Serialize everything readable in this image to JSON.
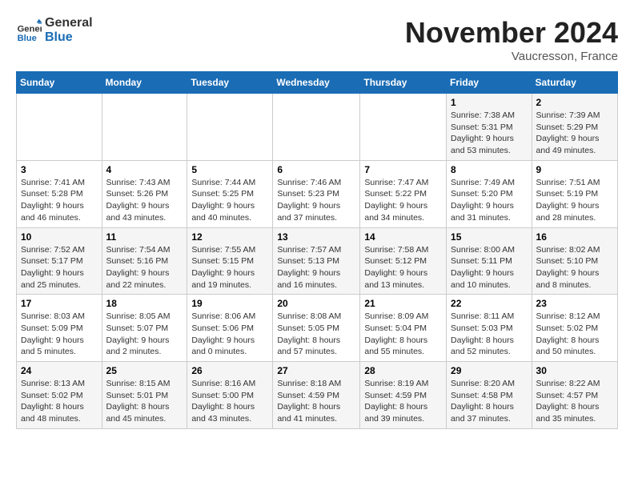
{
  "header": {
    "logo_line1": "General",
    "logo_line2": "Blue",
    "month": "November 2024",
    "location": "Vaucresson, France"
  },
  "weekdays": [
    "Sunday",
    "Monday",
    "Tuesday",
    "Wednesday",
    "Thursday",
    "Friday",
    "Saturday"
  ],
  "weeks": [
    [
      {
        "day": "",
        "info": ""
      },
      {
        "day": "",
        "info": ""
      },
      {
        "day": "",
        "info": ""
      },
      {
        "day": "",
        "info": ""
      },
      {
        "day": "",
        "info": ""
      },
      {
        "day": "1",
        "info": "Sunrise: 7:38 AM\nSunset: 5:31 PM\nDaylight: 9 hours and 53 minutes."
      },
      {
        "day": "2",
        "info": "Sunrise: 7:39 AM\nSunset: 5:29 PM\nDaylight: 9 hours and 49 minutes."
      }
    ],
    [
      {
        "day": "3",
        "info": "Sunrise: 7:41 AM\nSunset: 5:28 PM\nDaylight: 9 hours and 46 minutes."
      },
      {
        "day": "4",
        "info": "Sunrise: 7:43 AM\nSunset: 5:26 PM\nDaylight: 9 hours and 43 minutes."
      },
      {
        "day": "5",
        "info": "Sunrise: 7:44 AM\nSunset: 5:25 PM\nDaylight: 9 hours and 40 minutes."
      },
      {
        "day": "6",
        "info": "Sunrise: 7:46 AM\nSunset: 5:23 PM\nDaylight: 9 hours and 37 minutes."
      },
      {
        "day": "7",
        "info": "Sunrise: 7:47 AM\nSunset: 5:22 PM\nDaylight: 9 hours and 34 minutes."
      },
      {
        "day": "8",
        "info": "Sunrise: 7:49 AM\nSunset: 5:20 PM\nDaylight: 9 hours and 31 minutes."
      },
      {
        "day": "9",
        "info": "Sunrise: 7:51 AM\nSunset: 5:19 PM\nDaylight: 9 hours and 28 minutes."
      }
    ],
    [
      {
        "day": "10",
        "info": "Sunrise: 7:52 AM\nSunset: 5:17 PM\nDaylight: 9 hours and 25 minutes."
      },
      {
        "day": "11",
        "info": "Sunrise: 7:54 AM\nSunset: 5:16 PM\nDaylight: 9 hours and 22 minutes."
      },
      {
        "day": "12",
        "info": "Sunrise: 7:55 AM\nSunset: 5:15 PM\nDaylight: 9 hours and 19 minutes."
      },
      {
        "day": "13",
        "info": "Sunrise: 7:57 AM\nSunset: 5:13 PM\nDaylight: 9 hours and 16 minutes."
      },
      {
        "day": "14",
        "info": "Sunrise: 7:58 AM\nSunset: 5:12 PM\nDaylight: 9 hours and 13 minutes."
      },
      {
        "day": "15",
        "info": "Sunrise: 8:00 AM\nSunset: 5:11 PM\nDaylight: 9 hours and 10 minutes."
      },
      {
        "day": "16",
        "info": "Sunrise: 8:02 AM\nSunset: 5:10 PM\nDaylight: 9 hours and 8 minutes."
      }
    ],
    [
      {
        "day": "17",
        "info": "Sunrise: 8:03 AM\nSunset: 5:09 PM\nDaylight: 9 hours and 5 minutes."
      },
      {
        "day": "18",
        "info": "Sunrise: 8:05 AM\nSunset: 5:07 PM\nDaylight: 9 hours and 2 minutes."
      },
      {
        "day": "19",
        "info": "Sunrise: 8:06 AM\nSunset: 5:06 PM\nDaylight: 9 hours and 0 minutes."
      },
      {
        "day": "20",
        "info": "Sunrise: 8:08 AM\nSunset: 5:05 PM\nDaylight: 8 hours and 57 minutes."
      },
      {
        "day": "21",
        "info": "Sunrise: 8:09 AM\nSunset: 5:04 PM\nDaylight: 8 hours and 55 minutes."
      },
      {
        "day": "22",
        "info": "Sunrise: 8:11 AM\nSunset: 5:03 PM\nDaylight: 8 hours and 52 minutes."
      },
      {
        "day": "23",
        "info": "Sunrise: 8:12 AM\nSunset: 5:02 PM\nDaylight: 8 hours and 50 minutes."
      }
    ],
    [
      {
        "day": "24",
        "info": "Sunrise: 8:13 AM\nSunset: 5:02 PM\nDaylight: 8 hours and 48 minutes."
      },
      {
        "day": "25",
        "info": "Sunrise: 8:15 AM\nSunset: 5:01 PM\nDaylight: 8 hours and 45 minutes."
      },
      {
        "day": "26",
        "info": "Sunrise: 8:16 AM\nSunset: 5:00 PM\nDaylight: 8 hours and 43 minutes."
      },
      {
        "day": "27",
        "info": "Sunrise: 8:18 AM\nSunset: 4:59 PM\nDaylight: 8 hours and 41 minutes."
      },
      {
        "day": "28",
        "info": "Sunrise: 8:19 AM\nSunset: 4:59 PM\nDaylight: 8 hours and 39 minutes."
      },
      {
        "day": "29",
        "info": "Sunrise: 8:20 AM\nSunset: 4:58 PM\nDaylight: 8 hours and 37 minutes."
      },
      {
        "day": "30",
        "info": "Sunrise: 8:22 AM\nSunset: 4:57 PM\nDaylight: 8 hours and 35 minutes."
      }
    ]
  ]
}
